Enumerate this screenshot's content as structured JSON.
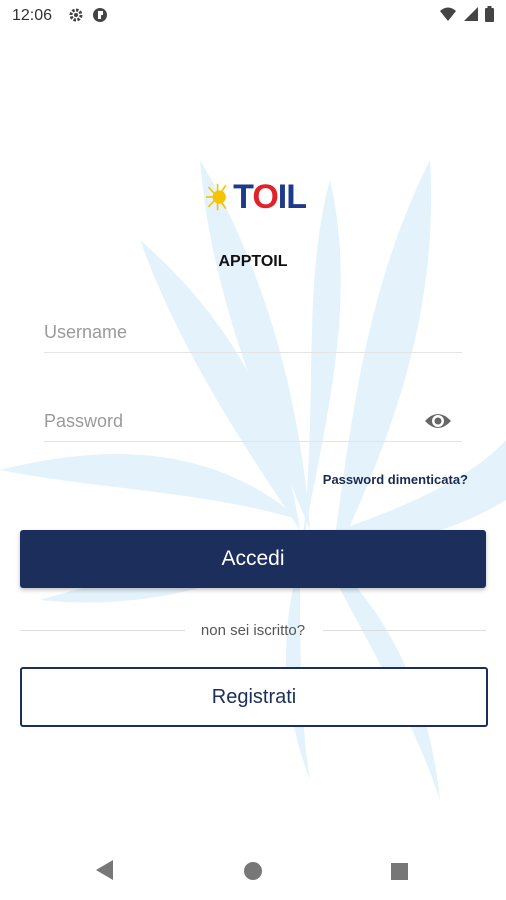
{
  "status_bar": {
    "time": "12:06",
    "left_icons": [
      "gear-icon",
      "pocket-icon"
    ],
    "right_icons": [
      "wifi-icon",
      "signal-icon",
      "battery-icon"
    ]
  },
  "logo": {
    "text_prefix": "T",
    "text_o": "O",
    "text_suffix": "IL",
    "sun_color": "#f5c400"
  },
  "app_name": "APPTOIL",
  "login": {
    "username_placeholder": "Username",
    "password_placeholder": "Password",
    "show_password_icon": "eye-icon",
    "forgot_password": "Password dimenticata?",
    "submit_label": "Accedi"
  },
  "register": {
    "divider_text": "non sei iscritto?",
    "button_label": "Registrati"
  },
  "nav_bar": [
    "back-icon",
    "home-icon",
    "recents-icon"
  ],
  "colors": {
    "primary": "#1c2e5b",
    "background_flower": "#e3f2fb",
    "logo_red": "#e0232a",
    "logo_blue": "#1e3a8a"
  }
}
